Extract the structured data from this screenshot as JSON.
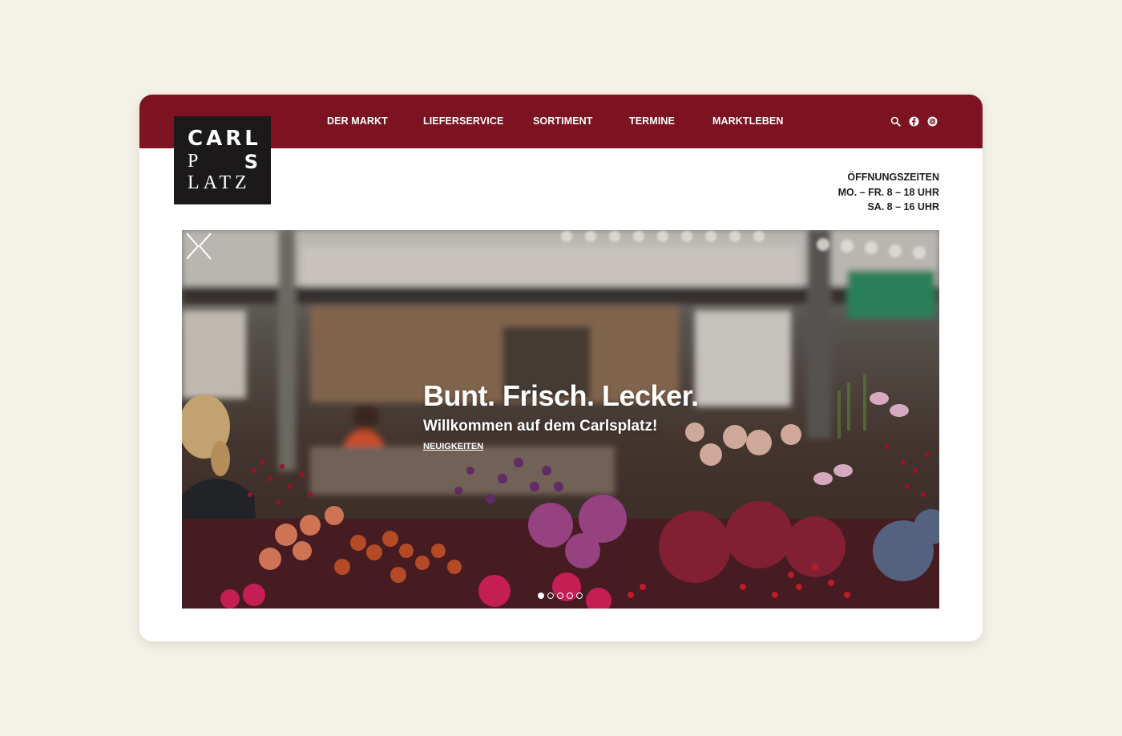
{
  "colors": {
    "background": "#f4f1e6",
    "brand": "#7d1221",
    "logo_bg": "#1b1919",
    "text": "#1d1d1d"
  },
  "logo": {
    "line1": "CARL",
    "line2_left": "P",
    "line2_right": "S",
    "line3": "LATZ"
  },
  "nav": {
    "items": [
      {
        "label": "DER MARKT"
      },
      {
        "label": "LIEFERSERVICE"
      },
      {
        "label": "SORTIMENT"
      },
      {
        "label": "TERMINE"
      },
      {
        "label": "MARKTLEBEN"
      }
    ]
  },
  "header_icons": [
    "search-icon",
    "facebook-icon",
    "instagram-icon"
  ],
  "hours": {
    "title": "ÖFFNUNGSZEITEN",
    "weekdays": "MO. – FR. 8 – 18 UHR",
    "saturday": "SA. 8 – 16 UHR"
  },
  "hero": {
    "title": "Bunt. Frisch. Lecker.",
    "subtitle": "Willkommen auf dem Carlsplatz!",
    "link": "NEUIGKEITEN",
    "slides_total": 5,
    "active_slide": 1
  }
}
